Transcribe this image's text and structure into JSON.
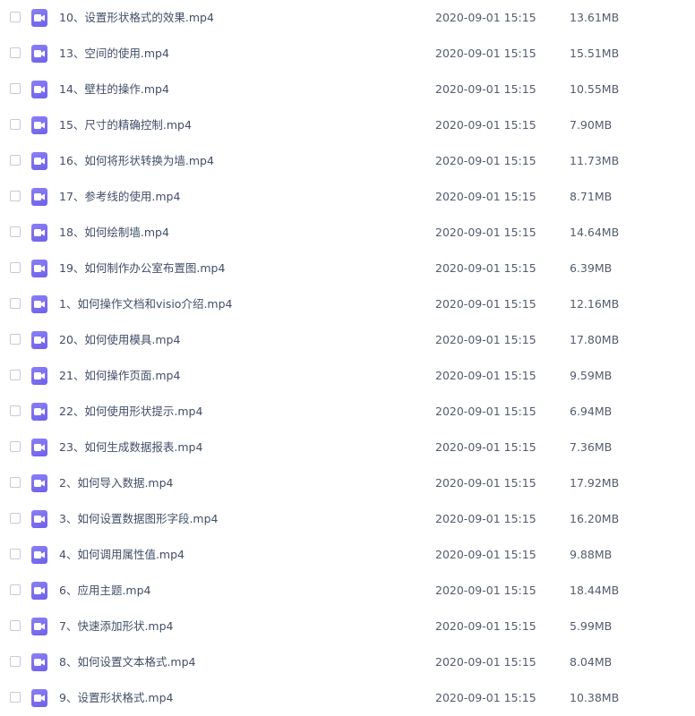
{
  "file_list": {
    "rows": [
      {
        "name": "10、设置形状格式的效果.mp4",
        "date": "2020-09-01 15:15",
        "size": "13.61MB",
        "icon": "video-file-icon"
      },
      {
        "name": "13、空间的使用.mp4",
        "date": "2020-09-01 15:15",
        "size": "15.51MB",
        "icon": "video-file-icon"
      },
      {
        "name": "14、壁柱的操作.mp4",
        "date": "2020-09-01 15:15",
        "size": "10.55MB",
        "icon": "video-file-icon"
      },
      {
        "name": "15、尺寸的精确控制.mp4",
        "date": "2020-09-01 15:15",
        "size": "7.90MB",
        "icon": "video-file-icon"
      },
      {
        "name": "16、如何将形状转换为墙.mp4",
        "date": "2020-09-01 15:15",
        "size": "11.73MB",
        "icon": "video-file-icon"
      },
      {
        "name": "17、参考线的使用.mp4",
        "date": "2020-09-01 15:15",
        "size": "8.71MB",
        "icon": "video-file-icon"
      },
      {
        "name": "18、如何绘制墙.mp4",
        "date": "2020-09-01 15:15",
        "size": "14.64MB",
        "icon": "video-file-icon"
      },
      {
        "name": "19、如何制作办公室布置图.mp4",
        "date": "2020-09-01 15:15",
        "size": "6.39MB",
        "icon": "video-file-icon"
      },
      {
        "name": "1、如何操作文档和visio介绍.mp4",
        "date": "2020-09-01 15:15",
        "size": "12.16MB",
        "icon": "video-file-icon"
      },
      {
        "name": "20、如何使用模具.mp4",
        "date": "2020-09-01 15:15",
        "size": "17.80MB",
        "icon": "video-file-icon"
      },
      {
        "name": "21、如何操作页面.mp4",
        "date": "2020-09-01 15:15",
        "size": "9.59MB",
        "icon": "video-file-icon"
      },
      {
        "name": "22、如何使用形状提示.mp4",
        "date": "2020-09-01 15:15",
        "size": "6.94MB",
        "icon": "video-file-icon"
      },
      {
        "name": "23、如何生成数据报表.mp4",
        "date": "2020-09-01 15:15",
        "size": "7.36MB",
        "icon": "video-file-icon"
      },
      {
        "name": "2、如何导入数据.mp4",
        "date": "2020-09-01 15:15",
        "size": "17.92MB",
        "icon": "video-file-icon"
      },
      {
        "name": "3、如何设置数据图形字段.mp4",
        "date": "2020-09-01 15:15",
        "size": "16.20MB",
        "icon": "video-file-icon"
      },
      {
        "name": "4、如何调用属性值.mp4",
        "date": "2020-09-01 15:15",
        "size": "9.88MB",
        "icon": "video-file-icon"
      },
      {
        "name": "6、应用主题.mp4",
        "date": "2020-09-01 15:15",
        "size": "18.44MB",
        "icon": "video-file-icon"
      },
      {
        "name": "7、快速添加形状.mp4",
        "date": "2020-09-01 15:15",
        "size": "5.99MB",
        "icon": "video-file-icon"
      },
      {
        "name": "8、如何设置文本格式.mp4",
        "date": "2020-09-01 15:15",
        "size": "8.04MB",
        "icon": "video-file-icon"
      },
      {
        "name": "9、设置形状格式.mp4",
        "date": "2020-09-01 15:15",
        "size": "10.38MB",
        "icon": "video-file-icon"
      }
    ]
  },
  "colors": {
    "icon_accent": "#7b6ff0",
    "text": "#424e67",
    "checkbox_border": "#c5cad3"
  }
}
